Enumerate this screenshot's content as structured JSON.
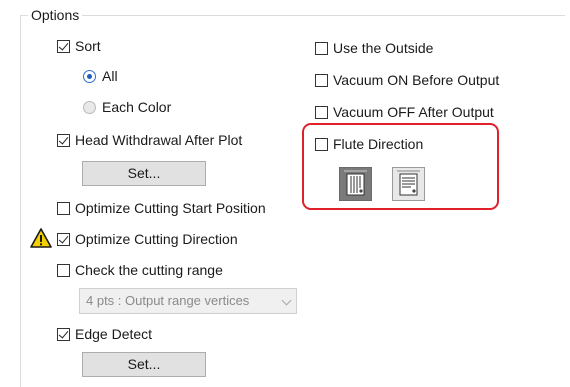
{
  "options": {
    "legend": "Options",
    "sort": {
      "label": "Sort",
      "checked": true
    },
    "sort_all": {
      "label": "All",
      "selected": true
    },
    "sort_each_color": {
      "label": "Each Color",
      "selected": false
    },
    "head_withdrawal": {
      "label": "Head Withdrawal After Plot",
      "checked": true
    },
    "head_withdrawal_set": "Set...",
    "optimize_start": {
      "label": "Optimize Cutting Start Position",
      "checked": false
    },
    "optimize_direction": {
      "label": "Optimize Cutting Direction",
      "checked": true,
      "icon": "warning-icon"
    },
    "check_range": {
      "label": "Check the cutting range",
      "checked": false
    },
    "range_select": {
      "value": "4 pts : Output range vertices",
      "disabled": true
    },
    "edge_detect": {
      "label": "Edge Detect",
      "checked": true
    },
    "edge_detect_set": "Set...",
    "use_outside": {
      "label": "Use the Outside",
      "checked": false
    },
    "vacuum_on": {
      "label": "Vacuum ON Before Output",
      "checked": false
    },
    "vacuum_off": {
      "label": "Vacuum OFF After Output",
      "checked": false
    },
    "flute_direction": {
      "label": "Flute Direction",
      "checked": false
    },
    "flute_buttons": [
      {
        "icon": "flute-vertical-icon",
        "selected": true
      },
      {
        "icon": "flute-horizontal-icon",
        "selected": false
      }
    ]
  },
  "colors": {
    "highlight": "#e0202a",
    "warning": "#f5d000",
    "radio_accent": "#1f5fbf"
  }
}
